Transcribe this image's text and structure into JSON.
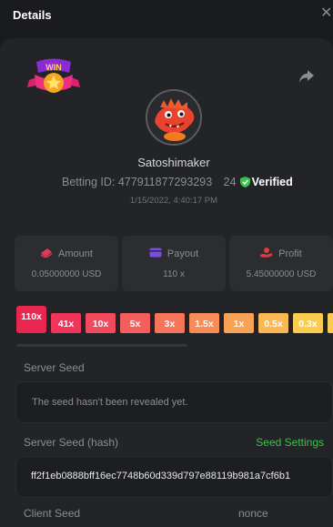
{
  "header": {
    "title": "Details",
    "close_glyph": "✕"
  },
  "user": {
    "name": "Satoshimaker",
    "betting_id_label": "Betting ID: 477911877293293 24",
    "verified_label": "Verified",
    "datetime": "1/15/2022, 4:40:17 PM"
  },
  "stats": [
    {
      "label": "Amount",
      "value": "0.05000000 USD",
      "icon": "coin-stack-icon",
      "icon_color": "#e03c5a"
    },
    {
      "label": "Payout",
      "value": "110 x",
      "icon": "wallet-icon",
      "icon_color": "#7a4de0"
    },
    {
      "label": "Profit",
      "value": "5.45000000 USD",
      "icon": "coins-hand-icon",
      "icon_color": "#e03c3c"
    }
  ],
  "multipliers": [
    {
      "label": "110x",
      "color": "#e8264f",
      "selected": true
    },
    {
      "label": "41x",
      "color": "#f0345a"
    },
    {
      "label": "10x",
      "color": "#f24a5c"
    },
    {
      "label": "5x",
      "color": "#f45e5c"
    },
    {
      "label": "3x",
      "color": "#f6745a"
    },
    {
      "label": "1.5x",
      "color": "#f88b58"
    },
    {
      "label": "1x",
      "color": "#f9a155"
    },
    {
      "label": "0.5x",
      "color": "#fab752"
    },
    {
      "label": "0.3x",
      "color": "#fbcd4e"
    },
    {
      "label": "",
      "color": "#fbcd4e"
    }
  ],
  "seeds": {
    "server_seed_label": "Server Seed",
    "server_seed_value": "The seed hasn't been revealed yet.",
    "server_seed_hash_label": "Server Seed (hash)",
    "seed_settings_label": "Seed Settings",
    "server_seed_hash_value": "ff2f1eb0888bff16ec7748b60d339d797e88119b981a7cf6b1",
    "client_seed_label": "Client Seed",
    "nonce_label": "nonce"
  },
  "colors": {
    "accent_green": "#3bc44b",
    "background": "#1a1b1e",
    "panel": "#232427"
  }
}
